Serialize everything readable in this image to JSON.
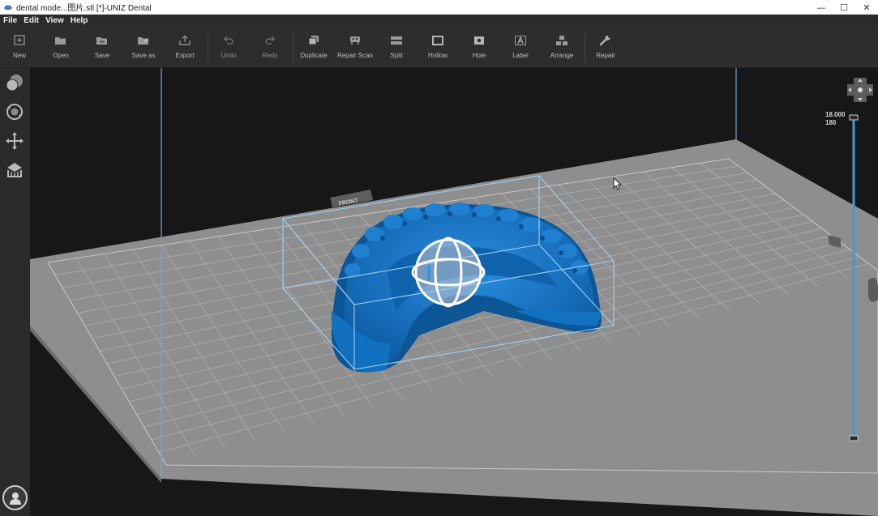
{
  "window": {
    "title": "dental mode...图片.stl [*]-UNIZ Dental",
    "minimize_glyph": "—",
    "maximize_glyph": "☐",
    "close_glyph": "✕"
  },
  "menu": [
    "File",
    "Edit",
    "View",
    "Help"
  ],
  "toolbar": {
    "new": "New",
    "open": "Open",
    "save": "Save",
    "save_as": "Save as",
    "export": "Export",
    "undo": "Undo",
    "redo": "Redo",
    "duplicate": "Duplicate",
    "repair_scan": "Repair Scan",
    "split": "Split",
    "hollow": "Hollow",
    "hole": "Hole",
    "label": "Label",
    "arrange": "Arrange",
    "repair": "Repair"
  },
  "side_tools": [
    "view-mode-icon",
    "rotate-icon",
    "move-icon",
    "support-icon"
  ],
  "viewport": {
    "front_label": "FRONT",
    "layer_slider": {
      "height_value": "18.000",
      "layer_value": "180"
    }
  },
  "colors": {
    "model": "#1e78c8",
    "bounding_box": "#8fc8f0",
    "platform": "#8c8c8c",
    "slider": "#3b9ae1"
  }
}
